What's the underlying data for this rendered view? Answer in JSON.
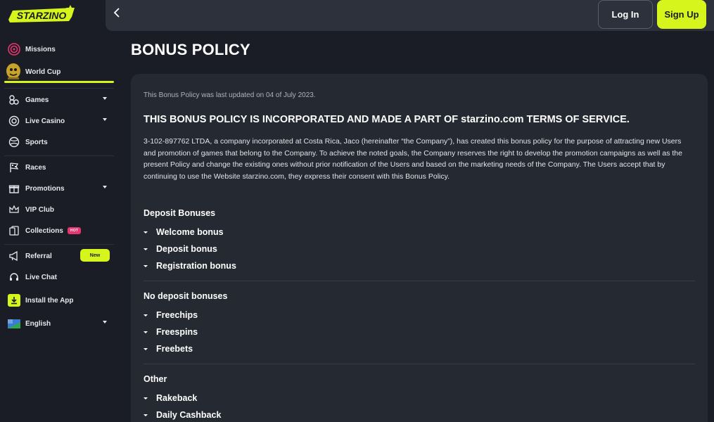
{
  "brand": {
    "name": "STARZINO",
    "accent": "#d6f51d",
    "hot_color": "#e8356f"
  },
  "sidebar": {
    "missions": "Missions",
    "world_cup": "World Cup",
    "games": "Games",
    "live_casino": "Live Casino",
    "sports": "Sports",
    "races": "Races",
    "promotions": "Promotions",
    "vip_club": "VIP Club",
    "collections": "Collections",
    "collections_badge": "HOT",
    "referral": "Referral",
    "referral_badge": "New",
    "live_chat": "Live Chat",
    "install_app": "Install the App",
    "language": "English"
  },
  "header": {
    "login_label": "Log In",
    "signup_label": "Sign Up"
  },
  "page": {
    "title": "BONUS POLICY",
    "updated": "This Bonus Policy was last updated on 04 of July 2023.",
    "incorporated": "THIS BONUS POLICY IS INCORPORATED AND MADE A PART OF starzino.com TERMS OF SERVICE.",
    "intro": "3-102-897762 LTDA, a company incorporated at Costa Rica, Jaco (hereinafter “the Company”), has created this bonus policy for the purpose of attracting new Users and promotion of games that belong to the Company. To achieve the noted goals, the Company reserves the right to develop the promotion campaigns as well as the present Policy and change the existing ones without prior notification of the Users and based on the marketing needs of the Company. The Users accept that by continuing to use the Website starzino.com, they express their consent with this Bonus Policy."
  },
  "sections": [
    {
      "title": "Deposit Bonuses",
      "items": [
        "Welcome bonus",
        "Deposit bonus",
        "Registration bonus"
      ]
    },
    {
      "title": "No deposit bonuses",
      "items": [
        "Freechips",
        "Freespins",
        "Freebets"
      ]
    },
    {
      "title": "Other",
      "items": [
        "Rakeback",
        "Daily Cashback"
      ]
    }
  ]
}
